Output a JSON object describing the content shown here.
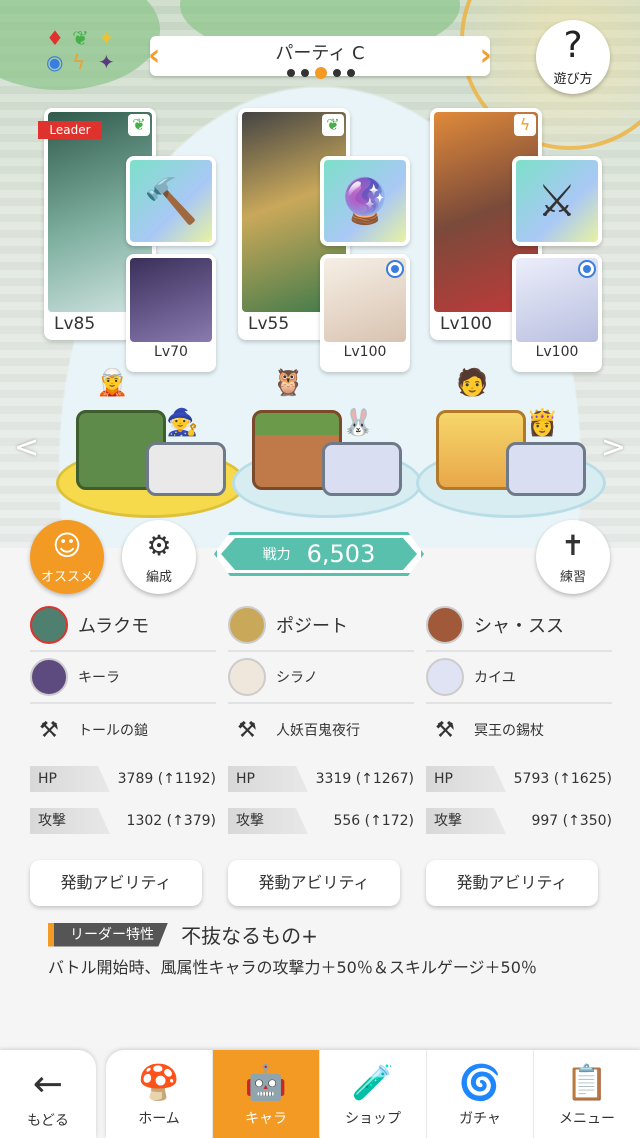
{
  "header": {
    "party_name": "パーティ C",
    "page_count": 5,
    "active_page": 3,
    "help_label": "遊び方"
  },
  "leader_tag": "Leader",
  "members": [
    {
      "main_lv": "Lv85",
      "sub_lv": "Lv70",
      "portrait_color": "#4f7f6f",
      "sub_color": "#5d4a7e",
      "block_color": "#5e8a4a"
    },
    {
      "main_lv": "Lv55",
      "sub_lv": "Lv100",
      "portrait_color": "#b69a4e",
      "sub_color": "#f0e0d0",
      "block_color": "#b3784a"
    },
    {
      "main_lv": "Lv100",
      "sub_lv": "Lv100",
      "portrait_color": "#a05a3a",
      "sub_color": "#dfe3f3",
      "block_color": "#f0c05a"
    }
  ],
  "buttons": {
    "recommend": "オススメ",
    "organize": "編成",
    "practice": "練習"
  },
  "power": {
    "label": "戦力",
    "value": "6,503"
  },
  "columns": [
    {
      "main_name": "ムラクモ",
      "sub_name": "キーラ",
      "weapon": "トールの鎚",
      "hp_label": "HP",
      "hp_value": "3789 (↑1192)",
      "atk_label": "攻撃",
      "atk_value": "1302 (↑379)",
      "ability": "発動アビリティ"
    },
    {
      "main_name": "ポジート",
      "sub_name": "シラノ",
      "weapon": "人妖百鬼夜行",
      "hp_label": "HP",
      "hp_value": "3319 (↑1267)",
      "atk_label": "攻撃",
      "atk_value": "556 (↑172)",
      "ability": "発動アビリティ"
    },
    {
      "main_name": "シャ・スス",
      "sub_name": "カイユ",
      "weapon": "冥王の錫杖",
      "hp_label": "HP",
      "hp_value": "5793 (↑1625)",
      "atk_label": "攻撃",
      "atk_value": "997 (↑350)",
      "ability": "発動アビリティ"
    }
  ],
  "leader_skill": {
    "tag": "リーダー特性",
    "name": "不抜なるもの+",
    "description": "バトル開始時、風属性キャラの攻撃力＋50％＆スキルゲージ＋50％"
  },
  "nav": {
    "back": "もどる",
    "items": [
      "ホーム",
      "キャラ",
      "ショップ",
      "ガチャ",
      "メニュー"
    ],
    "active": "キャラ"
  },
  "colors": {
    "accent": "#f29a24",
    "power": "#5ac0ae",
    "leader": "#e0322c"
  }
}
